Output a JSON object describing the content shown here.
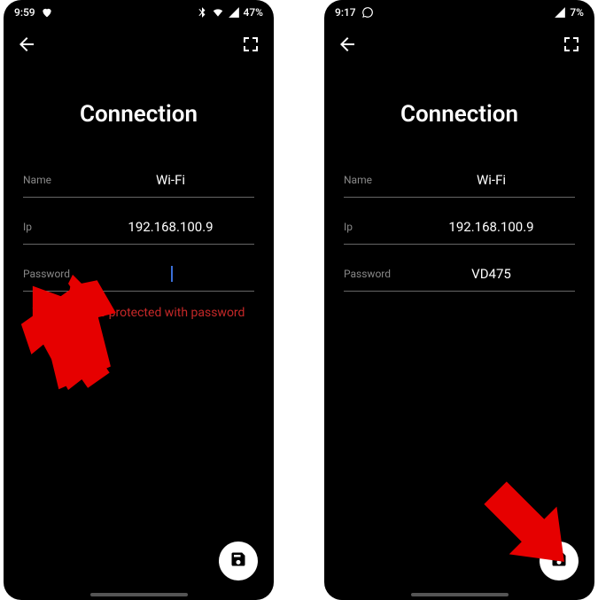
{
  "left": {
    "status": {
      "time": "9:59",
      "battery": "47%"
    },
    "title": "Connection",
    "fields": {
      "name_label": "Name",
      "name_value": "Wi-Fi",
      "ip_label": "Ip",
      "ip_value": "192.168.100.9",
      "password_label": "Password",
      "password_value": ""
    },
    "warning": "This server is protected with password"
  },
  "right": {
    "status": {
      "time": "9:17",
      "battery": "7%"
    },
    "title": "Connection",
    "fields": {
      "name_label": "Name",
      "name_value": "Wi-Fi",
      "ip_label": "Ip",
      "ip_value": "192.168.100.9",
      "password_label": "Password",
      "password_value": "VD475"
    }
  },
  "colors": {
    "warning": "#c62828",
    "accent": "#3a6fd8"
  }
}
